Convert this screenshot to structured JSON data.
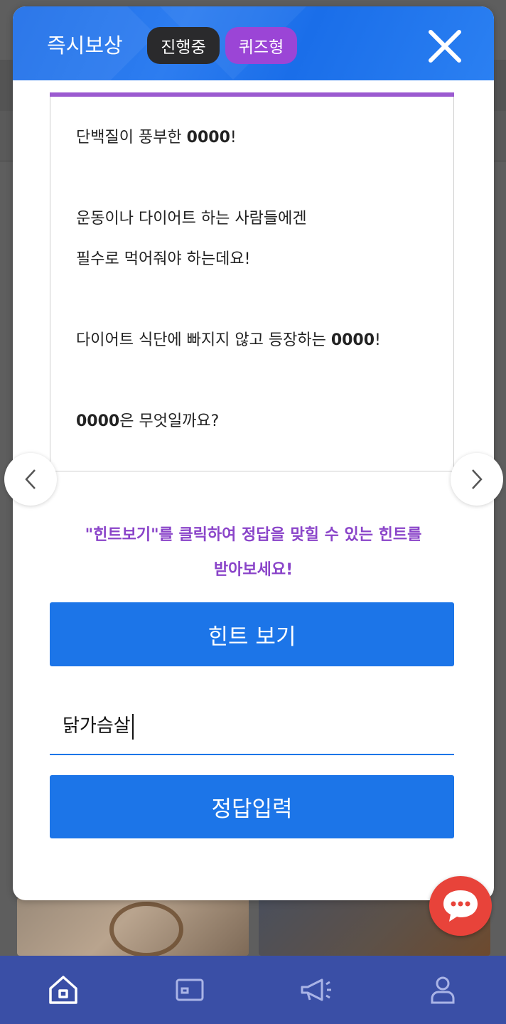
{
  "modal": {
    "title": "즉시보상",
    "status_badge": "진행중",
    "type_badge": "퀴즈형"
  },
  "quiz": {
    "line1_pre": "단백질이 풍부한 ",
    "line1_bold": "0000",
    "line1_post": "!",
    "line2": "운동이나 다이어트 하는 사람들에겐",
    "line3": "필수로 먹어줘야 하는데요!",
    "line4_pre": "다이어트 식단에 빠지지 않고 등장하는 ",
    "line4_bold": "0000",
    "line4_post": "!",
    "line5_bold": "0000",
    "line5_post": "은 무엇일까요?"
  },
  "hint": {
    "message_line1": "\"힌트보기\"를 클릭하여 정답을 맞힐 수 있는 힌트를",
    "message_line2": "받아보세요!",
    "button_label": "힌트 보기"
  },
  "answer": {
    "value": "닭가슴살",
    "submit_label": "정답입력"
  },
  "icons": {
    "close": "close-icon",
    "prev": "chevron-left-icon",
    "next": "chevron-right-icon",
    "chat": "chat-icon",
    "nav": [
      "home-icon",
      "wallet-icon",
      "megaphone-icon",
      "user-icon"
    ]
  },
  "colors": {
    "primary": "#1c75e8",
    "accent_purple": "#8a44c9",
    "header_blue": "#1f6fe8",
    "nav_bg": "#3a4fa6",
    "chat_red": "#e8433a"
  }
}
